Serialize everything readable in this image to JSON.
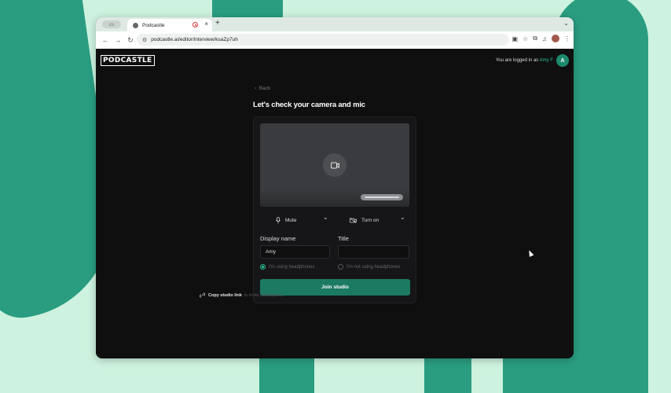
{
  "browser": {
    "tab_title": "Podcastle",
    "new_tab": "+",
    "tab_close": "×",
    "url": "podcastle.ai/editor/interview/ksaZp7uh"
  },
  "app": {
    "logo": "PODCASTLE",
    "login_prefix": "You are logged in as",
    "user_name": "Amy F",
    "avatar_letter": "A",
    "accent_color": "#2bbf97",
    "join_color": "#1c7a63"
  },
  "setup": {
    "back_label": "Back",
    "title": "Let's check your camera and mic",
    "mic_button": "Mute",
    "camera_button": "Turn on",
    "display_name_label": "Display name",
    "display_name_value": "Amy",
    "title_label": "Title",
    "title_value": "",
    "option_headphones": "I'm using headphones",
    "option_no_headphones": "I'm not using headphones",
    "join_button": "Join studio",
    "copy_link_label": "Copy studio link",
    "copy_link_hint": "to invite participants"
  }
}
